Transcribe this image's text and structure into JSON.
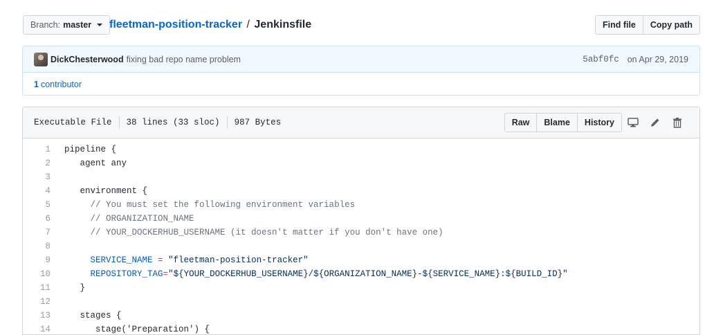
{
  "branch": {
    "label": "Branch:",
    "value": "master"
  },
  "breadcrumb": {
    "repo": "fleetman-position-tracker",
    "separator": "/",
    "file": "Jenkinsfile"
  },
  "header_buttons": {
    "find_file": "Find file",
    "copy_path": "Copy path"
  },
  "commit": {
    "author": "DickChesterwood",
    "message": "fixing bad repo name problem",
    "sha": "5abf0fc",
    "date": "on Apr 29, 2019",
    "contributors_count": "1",
    "contributors_label": "contributor"
  },
  "file_info": {
    "mode": "Executable File",
    "lines": "38 lines (33 sloc)",
    "size": "987 Bytes"
  },
  "file_buttons": {
    "raw": "Raw",
    "blame": "Blame",
    "history": "History"
  },
  "icons": {
    "desktop": "desktop-icon",
    "edit": "pencil-icon",
    "delete": "trash-icon"
  },
  "code_lines": [
    {
      "n": "1",
      "parts": [
        {
          "t": "pipeline {",
          "c": ""
        }
      ]
    },
    {
      "n": "2",
      "parts": [
        {
          "t": "   agent any",
          "c": ""
        }
      ]
    },
    {
      "n": "3",
      "parts": [
        {
          "t": "",
          "c": ""
        }
      ]
    },
    {
      "n": "4",
      "parts": [
        {
          "t": "   environment {",
          "c": ""
        }
      ]
    },
    {
      "n": "5",
      "parts": [
        {
          "t": "     // You must set the following environment variables",
          "c": "comment"
        }
      ]
    },
    {
      "n": "6",
      "parts": [
        {
          "t": "     // ORGANIZATION_NAME",
          "c": "comment"
        }
      ]
    },
    {
      "n": "7",
      "parts": [
        {
          "t": "     // YOUR_DOCKERHUB_USERNAME (it doesn't matter if you don't have one)",
          "c": "comment"
        }
      ]
    },
    {
      "n": "8",
      "parts": [
        {
          "t": "",
          "c": ""
        }
      ]
    },
    {
      "n": "9",
      "parts": [
        {
          "t": "     ",
          "c": ""
        },
        {
          "t": "SERVICE_NAME",
          "c": "var"
        },
        {
          "t": " = ",
          "c": "op"
        },
        {
          "t": "\"fleetman-position-tracker\"",
          "c": "str"
        }
      ]
    },
    {
      "n": "10",
      "parts": [
        {
          "t": "     ",
          "c": ""
        },
        {
          "t": "REPOSITORY_TAG",
          "c": "var"
        },
        {
          "t": "=",
          "c": "op"
        },
        {
          "t": "\"${YOUR_DOCKERHUB_USERNAME}/${ORGANIZATION_NAME}-${SERVICE_NAME}:${BUILD_ID}\"",
          "c": "str"
        }
      ]
    },
    {
      "n": "11",
      "parts": [
        {
          "t": "   }",
          "c": ""
        }
      ]
    },
    {
      "n": "12",
      "parts": [
        {
          "t": "",
          "c": ""
        }
      ]
    },
    {
      "n": "13",
      "parts": [
        {
          "t": "   stages {",
          "c": ""
        }
      ]
    },
    {
      "n": "14",
      "parts": [
        {
          "t": "      stage('Preparation') {",
          "c": ""
        }
      ]
    }
  ]
}
